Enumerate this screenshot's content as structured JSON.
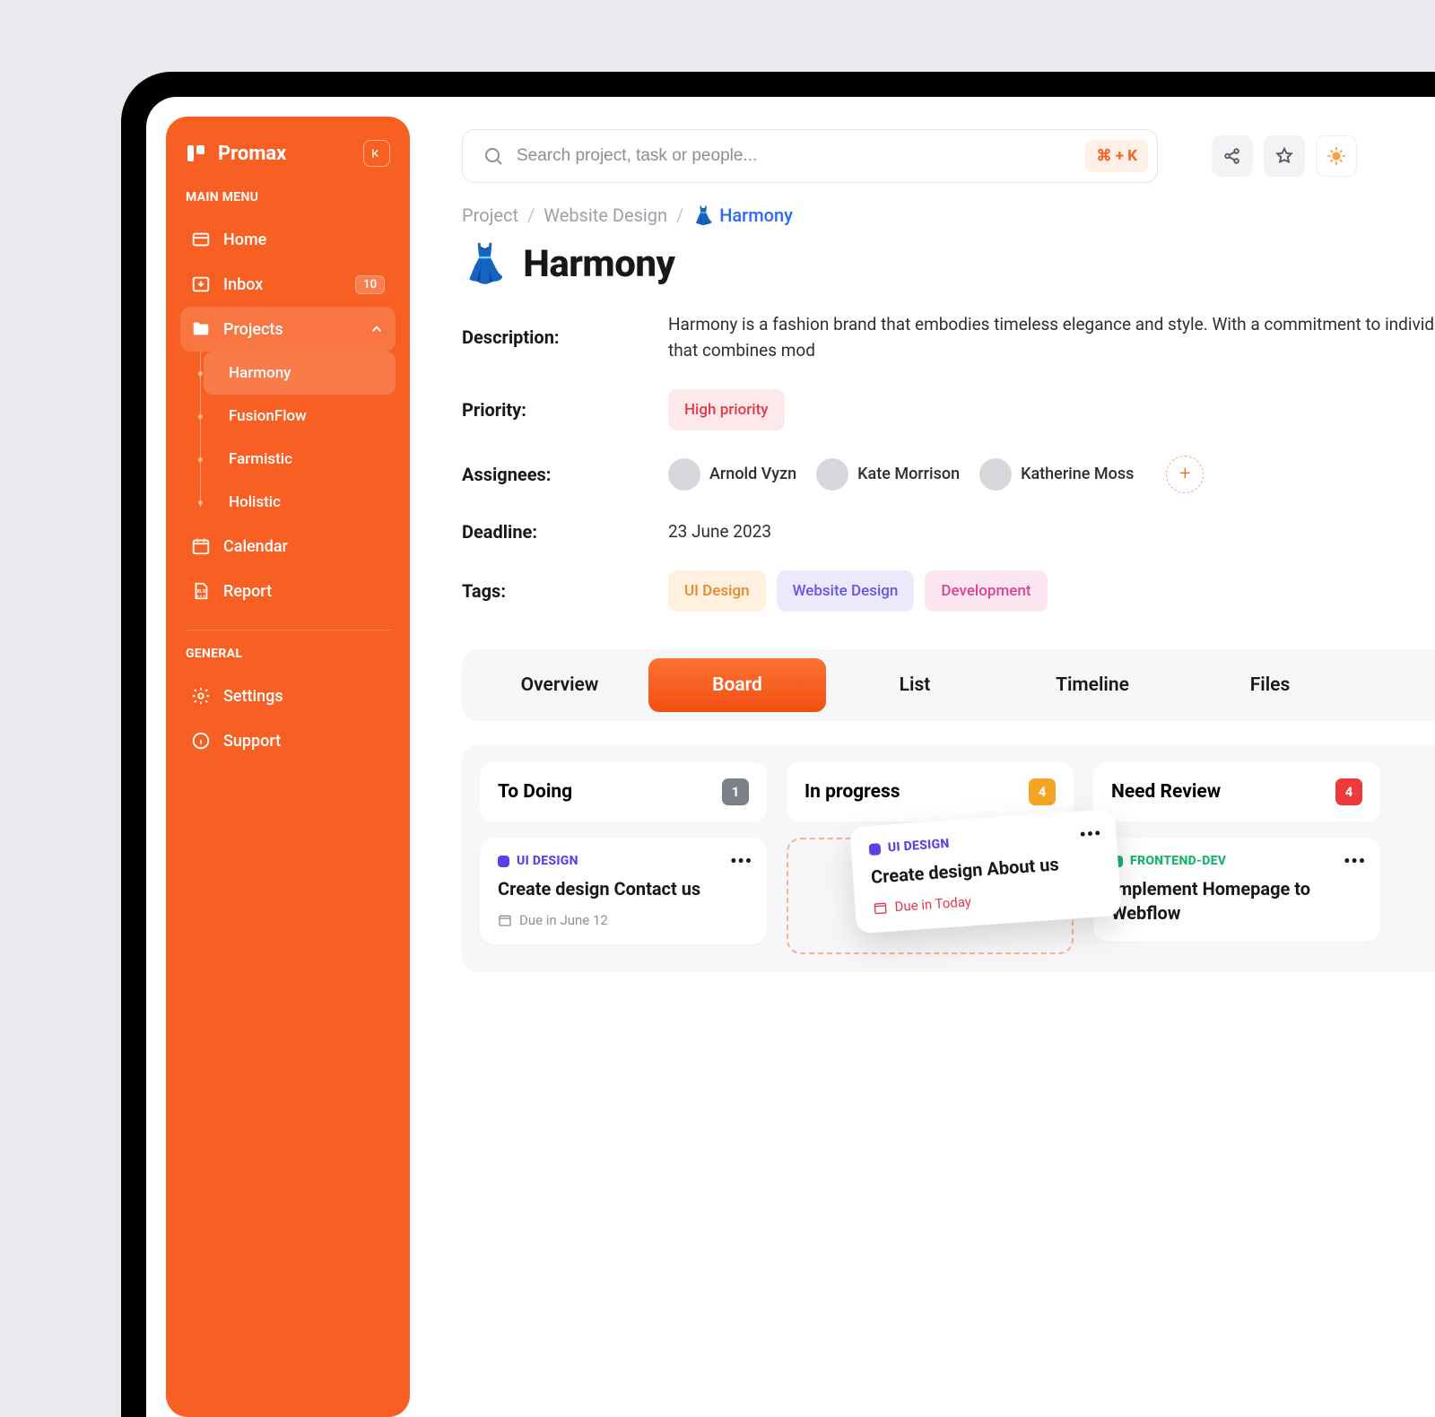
{
  "brand": "Promax",
  "section_main": "MAIN MENU",
  "section_general": "GENERAL",
  "nav": {
    "home": "Home",
    "inbox": "Inbox",
    "inbox_count": "10",
    "projects": "Projects",
    "calendar": "Calendar",
    "report": "Report",
    "settings": "Settings",
    "support": "Support"
  },
  "subprojects": [
    "Harmony",
    "FusionFlow",
    "Farmistic",
    "Holistic"
  ],
  "search": {
    "placeholder": "Search project, task or people...",
    "shortcut": "⌘ + K"
  },
  "breadcrumb": {
    "a": "Project",
    "b": "Website Design",
    "c_emoji": "👗",
    "c": "Harmony"
  },
  "page": {
    "emoji": "👗",
    "title": "Harmony",
    "labels": {
      "description": "Description:",
      "priority": "Priority:",
      "assignees": "Assignees:",
      "deadline": "Deadline:",
      "tags": "Tags:"
    },
    "description": "Harmony is a fashion brand that embodies timeless elegance and style. With a commitment to individuality, Harmony offers a diverse range of high-quality clothing that combines mod",
    "priority": "High priority",
    "assignees": [
      "Arnold Vyzn",
      "Kate Morrison",
      "Katherine Moss"
    ],
    "deadline": "23 June 2023",
    "tags": [
      "UI Design",
      "Website Design",
      "Development"
    ]
  },
  "tabs": [
    "Overview",
    "Board",
    "List",
    "Timeline",
    "Files"
  ],
  "columns": [
    {
      "title": "To Doing",
      "count": "1",
      "countClass": "count-grey"
    },
    {
      "title": "In progress",
      "count": "4",
      "countClass": "count-amber"
    },
    {
      "title": "Need Review",
      "count": "4",
      "countClass": "count-red"
    }
  ],
  "cards": {
    "todo": {
      "cat": "UI DESIGN",
      "title": "Create design Contact us",
      "due": "Due in June 12"
    },
    "floating": {
      "cat": "UI DESIGN",
      "title": "Create design About us",
      "due": "Due in Today"
    },
    "review": {
      "cat": "FRONTEND-DEV",
      "title": "Implement Homepage to Webflow"
    }
  }
}
